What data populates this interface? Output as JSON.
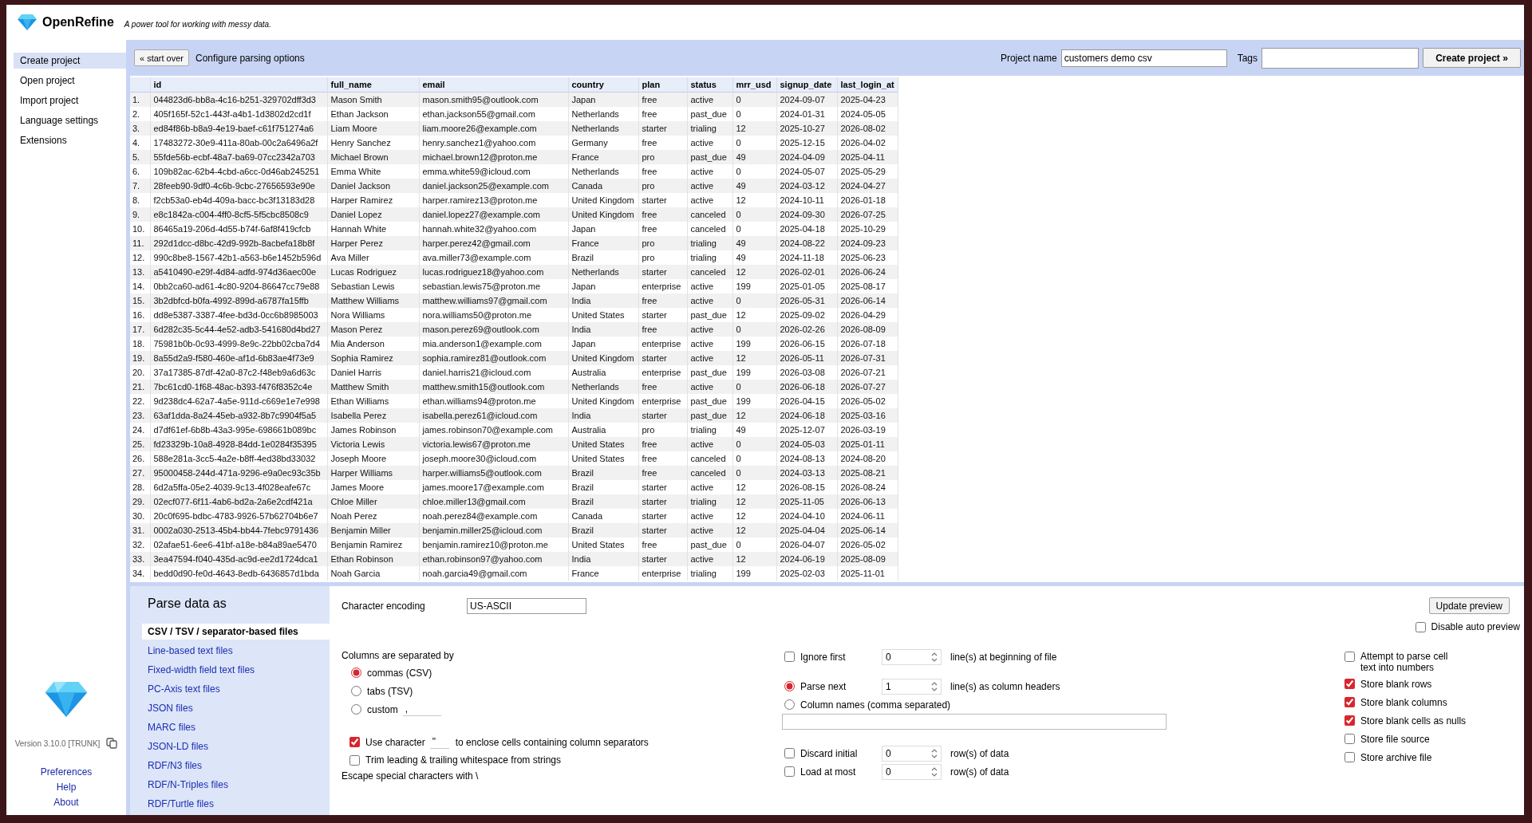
{
  "header": {
    "app_name": "OpenRefine",
    "tagline": "A power tool for working with messy data."
  },
  "sidebar": {
    "items": [
      {
        "label": "Create project",
        "selected": true
      },
      {
        "label": "Open project",
        "selected": false
      },
      {
        "label": "Import project",
        "selected": false
      },
      {
        "label": "Language settings",
        "selected": false
      },
      {
        "label": "Extensions",
        "selected": false
      }
    ],
    "version": "Version 3.10.0 [TRUNK]",
    "links": [
      "Preferences",
      "Help",
      "About"
    ]
  },
  "toolbar": {
    "start_over_button": "« start over",
    "title": "Configure parsing options",
    "project_name_label": "Project name",
    "project_name": "customers demo csv",
    "tags_label": "Tags",
    "create_button": "Create project »"
  },
  "table": {
    "columns": [
      "id",
      "full_name",
      "email",
      "country",
      "plan",
      "status",
      "mrr_usd",
      "signup_date",
      "last_login_at"
    ],
    "rows": [
      {
        "number": "1.",
        "cells": [
          "044823d6-bb8a-4c16-b251-329702dff3d3",
          "Mason Smith",
          "mason.smith95@outlook.com",
          "Japan",
          "free",
          "active",
          "0",
          "2024-09-07",
          "2025-04-23"
        ]
      },
      {
        "number": "2.",
        "cells": [
          "405f165f-52c1-443f-a4b1-1d3802d2cd1f",
          "Ethan Jackson",
          "ethan.jackson55@gmail.com",
          "Netherlands",
          "free",
          "past_due",
          "0",
          "2024-01-31",
          "2024-05-05"
        ]
      },
      {
        "number": "3.",
        "cells": [
          "ed84f86b-b8a9-4e19-baef-c61f751274a6",
          "Liam Moore",
          "liam.moore26@example.com",
          "Netherlands",
          "starter",
          "trialing",
          "12",
          "2025-10-27",
          "2026-08-02"
        ]
      },
      {
        "number": "4.",
        "cells": [
          "17483272-30e9-411a-80ab-00c2a6496a2f",
          "Henry Sanchez",
          "henry.sanchez1@yahoo.com",
          "Germany",
          "free",
          "active",
          "0",
          "2025-12-15",
          "2026-04-02"
        ]
      },
      {
        "number": "5.",
        "cells": [
          "55fde56b-ecbf-48a7-ba69-07cc2342a703",
          "Michael Brown",
          "michael.brown12@proton.me",
          "France",
          "pro",
          "past_due",
          "49",
          "2024-04-09",
          "2025-04-11"
        ]
      },
      {
        "number": "6.",
        "cells": [
          "109b82ac-62b4-4cbd-a6cc-0d46ab245251",
          "Emma White",
          "emma.white59@icloud.com",
          "Netherlands",
          "free",
          "active",
          "0",
          "2024-05-07",
          "2025-05-29"
        ]
      },
      {
        "number": "7.",
        "cells": [
          "28feeb90-9df0-4c6b-9cbc-27656593e90e",
          "Daniel Jackson",
          "daniel.jackson25@example.com",
          "Canada",
          "pro",
          "active",
          "49",
          "2024-03-12",
          "2024-04-27"
        ]
      },
      {
        "number": "8.",
        "cells": [
          "f2cb53a0-eb4d-409a-bacc-bc3f13183d28",
          "Harper Ramirez",
          "harper.ramirez13@proton.me",
          "United Kingdom",
          "starter",
          "active",
          "12",
          "2024-10-11",
          "2026-01-18"
        ]
      },
      {
        "number": "9.",
        "cells": [
          "e8c1842a-c004-4ff0-8cf5-5f5cbc8508c9",
          "Daniel Lopez",
          "daniel.lopez27@example.com",
          "United Kingdom",
          "free",
          "canceled",
          "0",
          "2024-09-30",
          "2026-07-25"
        ]
      },
      {
        "number": "10.",
        "cells": [
          "86465a19-206d-4d55-b74f-6af8f419cfcb",
          "Hannah White",
          "hannah.white32@yahoo.com",
          "Japan",
          "free",
          "canceled",
          "0",
          "2025-04-18",
          "2025-10-29"
        ]
      },
      {
        "number": "11.",
        "cells": [
          "292d1dcc-d8bc-42d9-992b-8acbefa18b8f",
          "Harper Perez",
          "harper.perez42@gmail.com",
          "France",
          "pro",
          "trialing",
          "49",
          "2024-08-22",
          "2024-09-23"
        ]
      },
      {
        "number": "12.",
        "cells": [
          "990c8be8-1567-42b1-a563-b6e1452b596d",
          "Ava Miller",
          "ava.miller73@example.com",
          "Brazil",
          "pro",
          "trialing",
          "49",
          "2024-11-18",
          "2025-06-23"
        ]
      },
      {
        "number": "13.",
        "cells": [
          "a5410490-e29f-4d84-adfd-974d36aec00e",
          "Lucas Rodriguez",
          "lucas.rodriguez18@yahoo.com",
          "Netherlands",
          "starter",
          "canceled",
          "12",
          "2026-02-01",
          "2026-06-24"
        ]
      },
      {
        "number": "14.",
        "cells": [
          "0bb2ca60-ad61-4c80-9204-86647cc79e88",
          "Sebastian Lewis",
          "sebastian.lewis75@proton.me",
          "Japan",
          "enterprise",
          "active",
          "199",
          "2025-01-05",
          "2025-08-17"
        ]
      },
      {
        "number": "15.",
        "cells": [
          "3b2dbfcd-b0fa-4992-899d-a6787fa15ffb",
          "Matthew Williams",
          "matthew.williams97@gmail.com",
          "India",
          "free",
          "active",
          "0",
          "2026-05-31",
          "2026-06-14"
        ]
      },
      {
        "number": "16.",
        "cells": [
          "dd8e5387-3387-4fee-bd3d-0cc6b8985003",
          "Nora Williams",
          "nora.williams50@proton.me",
          "United States",
          "starter",
          "past_due",
          "12",
          "2025-09-02",
          "2026-04-29"
        ]
      },
      {
        "number": "17.",
        "cells": [
          "6d282c35-5c44-4e52-adb3-541680d4bd27",
          "Mason Perez",
          "mason.perez69@outlook.com",
          "India",
          "free",
          "active",
          "0",
          "2026-02-26",
          "2026-08-09"
        ]
      },
      {
        "number": "18.",
        "cells": [
          "75981b0b-0c93-4999-8e9c-22bb02cba7d4",
          "Mia Anderson",
          "mia.anderson1@example.com",
          "Japan",
          "enterprise",
          "active",
          "199",
          "2026-06-15",
          "2026-07-18"
        ]
      },
      {
        "number": "19.",
        "cells": [
          "8a55d2a9-f580-460e-af1d-6b83ae4f73e9",
          "Sophia Ramirez",
          "sophia.ramirez81@outlook.com",
          "United Kingdom",
          "starter",
          "active",
          "12",
          "2026-05-11",
          "2026-07-31"
        ]
      },
      {
        "number": "20.",
        "cells": [
          "37a17385-87df-42a0-87c2-f48eb9a6d63c",
          "Daniel Harris",
          "daniel.harris21@icloud.com",
          "Australia",
          "enterprise",
          "past_due",
          "199",
          "2026-03-08",
          "2026-07-21"
        ]
      },
      {
        "number": "21.",
        "cells": [
          "7bc61cd0-1f68-48ac-b393-f476f8352c4e",
          "Matthew Smith",
          "matthew.smith15@outlook.com",
          "Netherlands",
          "free",
          "active",
          "0",
          "2026-06-18",
          "2026-07-27"
        ]
      },
      {
        "number": "22.",
        "cells": [
          "9d238dc4-62a7-4a5e-911d-c669e1e7e998",
          "Ethan Williams",
          "ethan.williams94@proton.me",
          "United Kingdom",
          "enterprise",
          "past_due",
          "199",
          "2026-04-15",
          "2026-05-02"
        ]
      },
      {
        "number": "23.",
        "cells": [
          "63af1dda-8a24-45eb-a932-8b7c9904f5a5",
          "Isabella Perez",
          "isabella.perez61@icloud.com",
          "India",
          "starter",
          "past_due",
          "12",
          "2024-06-18",
          "2025-03-16"
        ]
      },
      {
        "number": "24.",
        "cells": [
          "d7df61ef-6b8b-43a3-995e-698661b089bc",
          "James Robinson",
          "james.robinson70@example.com",
          "Australia",
          "pro",
          "trialing",
          "49",
          "2025-12-07",
          "2026-03-19"
        ]
      },
      {
        "number": "25.",
        "cells": [
          "fd23329b-10a8-4928-84dd-1e0284f35395",
          "Victoria Lewis",
          "victoria.lewis67@proton.me",
          "United States",
          "free",
          "active",
          "0",
          "2024-05-03",
          "2025-01-11"
        ]
      },
      {
        "number": "26.",
        "cells": [
          "588e281a-3cc5-4a2e-b8ff-4ed38bd33032",
          "Joseph Moore",
          "joseph.moore30@icloud.com",
          "United States",
          "free",
          "canceled",
          "0",
          "2024-08-13",
          "2024-08-20"
        ]
      },
      {
        "number": "27.",
        "cells": [
          "95000458-244d-471a-9296-e9a0ec93c35b",
          "Harper Williams",
          "harper.williams5@outlook.com",
          "Brazil",
          "free",
          "canceled",
          "0",
          "2024-03-13",
          "2025-08-21"
        ]
      },
      {
        "number": "28.",
        "cells": [
          "6d2a5ffa-05e2-4039-9c13-4f028eafe67c",
          "James Moore",
          "james.moore17@example.com",
          "Brazil",
          "starter",
          "active",
          "12",
          "2026-08-15",
          "2026-08-24"
        ]
      },
      {
        "number": "29.",
        "cells": [
          "02ecf077-6f11-4ab6-bd2a-2a6e2cdf421a",
          "Chloe Miller",
          "chloe.miller13@gmail.com",
          "Brazil",
          "starter",
          "trialing",
          "12",
          "2025-11-05",
          "2026-06-13"
        ]
      },
      {
        "number": "30.",
        "cells": [
          "20c0f695-bdbc-4783-9926-57b62704b6e7",
          "Noah Perez",
          "noah.perez84@example.com",
          "Canada",
          "starter",
          "active",
          "12",
          "2024-04-10",
          "2024-06-11"
        ]
      },
      {
        "number": "31.",
        "cells": [
          "0002a030-2513-45b4-bb44-7febc9791436",
          "Benjamin Miller",
          "benjamin.miller25@icloud.com",
          "Brazil",
          "starter",
          "active",
          "12",
          "2025-04-04",
          "2025-06-14"
        ]
      },
      {
        "number": "32.",
        "cells": [
          "02afae51-6ee6-41bf-a18e-b84a89ae5470",
          "Benjamin Ramirez",
          "benjamin.ramirez10@proton.me",
          "United States",
          "free",
          "past_due",
          "0",
          "2026-04-07",
          "2026-05-02"
        ]
      },
      {
        "number": "33.",
        "cells": [
          "3ea47594-f040-435d-ac9d-ee2d1724dca1",
          "Ethan Robinson",
          "ethan.robinson97@yahoo.com",
          "India",
          "starter",
          "active",
          "12",
          "2024-06-19",
          "2025-08-09"
        ]
      },
      {
        "number": "34.",
        "cells": [
          "bedd0d90-fe0d-4643-8edb-6436857d1bda",
          "Noah Garcia",
          "noah.garcia49@gmail.com",
          "France",
          "enterprise",
          "trialing",
          "199",
          "2025-02-03",
          "2025-11-01"
        ]
      }
    ]
  },
  "parse_panel": {
    "title": "Parse data as",
    "formats": [
      {
        "label": "CSV / TSV / separator-based files",
        "selected": true
      },
      {
        "label": "Line-based text files",
        "selected": false
      },
      {
        "label": "Fixed-width field text files",
        "selected": false
      },
      {
        "label": "PC-Axis text files",
        "selected": false
      },
      {
        "label": "JSON files",
        "selected": false
      },
      {
        "label": "MARC files",
        "selected": false
      },
      {
        "label": "JSON-LD files",
        "selected": false
      },
      {
        "label": "RDF/N3 files",
        "selected": false
      },
      {
        "label": "RDF/N-Triples files",
        "selected": false
      },
      {
        "label": "RDF/Turtle files",
        "selected": false
      }
    ]
  },
  "options": {
    "encoding": {
      "label": "Character encoding",
      "value": "US-ASCII"
    },
    "update_button": "Update preview",
    "auto_preview": {
      "label": "Disable auto preview",
      "checked": false
    },
    "separator": {
      "label": "Columns are separated by",
      "choices": [
        {
          "label": "commas (CSV)",
          "selected": true
        },
        {
          "label": "tabs (TSV)",
          "selected": false
        },
        {
          "label": "custom",
          "selected": false,
          "value": ","
        }
      ]
    },
    "quote": {
      "checked": true,
      "label": "Use character",
      "value": "\"",
      "suffix": "to enclose cells containing column separators"
    },
    "trim": {
      "checked": false,
      "label": "Trim leading & trailing whitespace from strings"
    },
    "escape": "Escape special characters with \\",
    "ignore_first": {
      "checked": false,
      "label": "Ignore first",
      "value": "0",
      "suffix": "line(s) at beginning of file"
    },
    "header_modes": [
      {
        "kind": "count",
        "selected": true,
        "label": "Parse next",
        "value": "1",
        "suffix": "line(s) as column headers"
      },
      {
        "kind": "names",
        "selected": false,
        "label": "Column names (comma separated)"
      }
    ],
    "data_limits": [
      {
        "checked": false,
        "label": "Discard initial",
        "value": "0",
        "suffix": "row(s) of data"
      },
      {
        "checked": false,
        "label": "Load at most",
        "value": "0",
        "suffix": "row(s) of data"
      }
    ],
    "store_options": [
      {
        "checked": false,
        "label": "Attempt to parse cell text into numbers"
      },
      {
        "checked": true,
        "label": "Store blank rows"
      },
      {
        "checked": true,
        "label": "Store blank columns"
      },
      {
        "checked": true,
        "label": "Store blank cells as nulls"
      },
      {
        "checked": false,
        "label": "Store file source"
      },
      {
        "checked": false,
        "label": "Store archive file"
      }
    ]
  }
}
